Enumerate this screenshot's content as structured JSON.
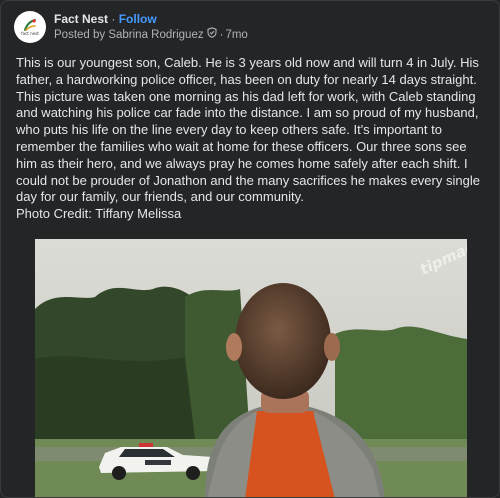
{
  "post": {
    "page_name": "Fact Nest",
    "separator": "·",
    "follow_label": "Follow",
    "posted_by": "Posted by Sabrina Rodriguez",
    "timestamp": "7mo",
    "avatar_text": "fact nest",
    "text": "This is our youngest son, Caleb. He is 3 years old now and will turn 4 in July. His father, a hardworking police officer, has been on duty for nearly 14 days straight. This picture was taken one morning as his dad left for work, with Caleb standing and watching his police car fade into the distance. I am so proud of my husband, who puts his life on the line every day to keep others safe. It's important to remember the families who wait at home for these officers. Our three sons see him as their hero, and we always pray he comes home safely after each shift. I could not be prouder of Jonathon and the many sacrifices he makes every single day for our family, our friends, and our community.",
    "photo_credit": "Photo Credit: Tiffany Melissa",
    "watermark": "tipmag.com"
  },
  "icons": {
    "avatar_logo": "fact-nest-logo-icon",
    "shield": "shield-icon"
  },
  "colors": {
    "background": "#242526",
    "text": "#e4e6eb",
    "secondary_text": "#b0b3b8",
    "follow": "#4599ff"
  }
}
